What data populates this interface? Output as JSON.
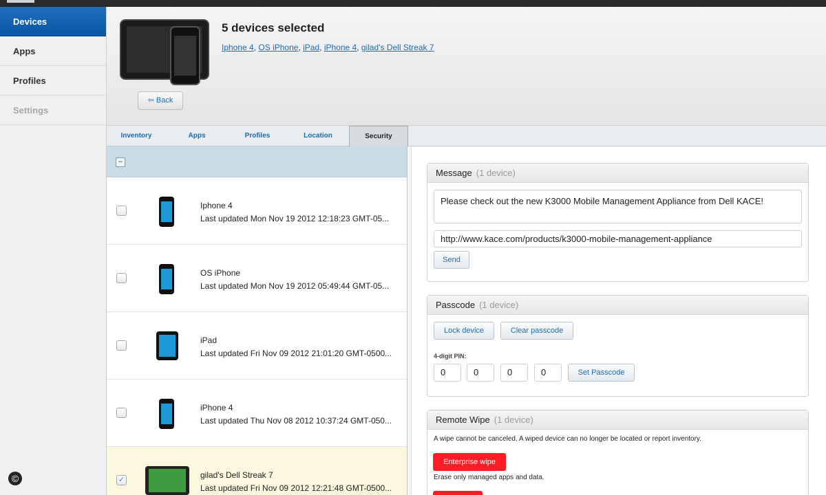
{
  "sidebar": {
    "items": [
      {
        "label": "Devices"
      },
      {
        "label": "Apps"
      },
      {
        "label": "Profiles"
      },
      {
        "label": "Settings"
      }
    ]
  },
  "header": {
    "title": "5 devices selected",
    "device_links": [
      "Iphone 4",
      "OS iPhone",
      "iPad",
      "iPhone 4",
      "gilad's Dell Streak 7"
    ],
    "back_label": "Back"
  },
  "tabs": [
    {
      "label": "Inventory"
    },
    {
      "label": "Apps"
    },
    {
      "label": "Profiles"
    },
    {
      "label": "Location"
    },
    {
      "label": "Security",
      "active": true
    }
  ],
  "devices": [
    {
      "name": "Iphone 4",
      "updated": "Last updated Mon Nov 19 2012 12:18:23 GMT-05...",
      "checked": false
    },
    {
      "name": "OS iPhone",
      "updated": "Last updated Mon Nov 19 2012 05:49:44 GMT-05...",
      "checked": false
    },
    {
      "name": "iPad",
      "updated": "Last updated Fri Nov 09 2012 21:01:20 GMT-0500...",
      "checked": false
    },
    {
      "name": "iPhone 4",
      "updated": "Last updated Thu Nov 08 2012 10:37:24 GMT-050...",
      "checked": false
    },
    {
      "name": "gilad's Dell Streak 7",
      "updated": "Last updated Fri Nov 09 2012 12:21:48 GMT-0500...",
      "checked": true
    }
  ],
  "message": {
    "title": "Message",
    "count": "(1 device)",
    "text_value": "Please check out the new K3000 Mobile Management Appliance from Dell KACE!",
    "url_value": "http://www.kace.com/products/k3000-mobile-management-appliance",
    "send_label": "Send"
  },
  "passcode": {
    "title": "Passcode",
    "count": "(1 device)",
    "lock_label": "Lock device",
    "clear_label": "Clear passcode",
    "pin_label": "4-digit PIN:",
    "pin_values": [
      "0",
      "0",
      "0",
      "0"
    ],
    "set_label": "Set Passcode"
  },
  "wipe": {
    "title": "Remote Wipe",
    "count": "(1 device)",
    "warning": "A wipe cannot be canceled. A wiped device can no longer be located or report inventory.",
    "enterprise_label": "Enterprise wipe",
    "enterprise_note": "Erase only managed apps and data."
  },
  "footer": {
    "copyright": "©"
  },
  "colors": {
    "accent": "#1e6bb0",
    "sidebar_active": "#0b56a3",
    "wipe_red": "#ff1c24",
    "selected_row": "#fcf7df"
  },
  "icons": [
    "back-arrow-icon",
    "phone-icon",
    "tablet-icon",
    "android-icon",
    "checkbox-icon"
  ]
}
